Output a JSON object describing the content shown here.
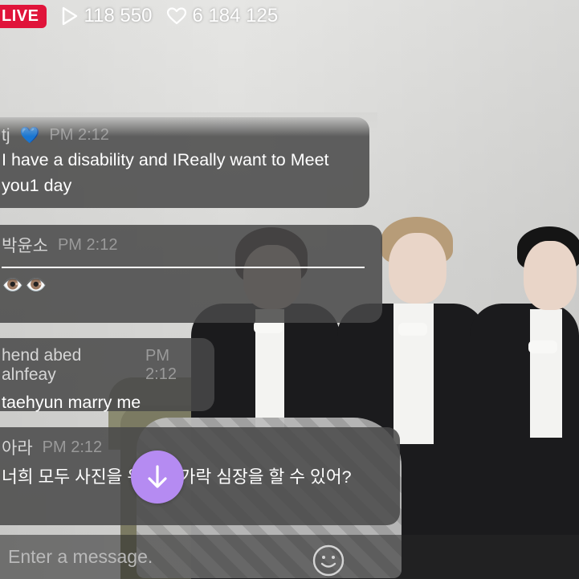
{
  "live": {
    "badge": "LIVE"
  },
  "stats": {
    "views": "118 550",
    "likes": "6 184 125"
  },
  "chat": {
    "messages": [
      {
        "author": "tj",
        "author_emoji": "💙",
        "time": "PM 2:12",
        "text": "I have a disability and IReally want to Meet you1 day"
      },
      {
        "author": "박윤소",
        "time": "PM 2:12",
        "text": "👁️👁️"
      },
      {
        "author": "hend abed alnfeay",
        "time": "PM 2:12",
        "text": "taehyun marry me"
      },
      {
        "author": "아라",
        "time": "PM 2:12",
        "text": "너희 모두 사진을 위해 손가락 심장을 할 수 있어?"
      }
    ]
  },
  "input": {
    "placeholder": "Enter a message."
  },
  "icons": {
    "play": "play-icon",
    "heart": "heart-icon",
    "scroll": "arrow-down-icon",
    "emoji": "smiley-icon"
  },
  "colors": {
    "live": "#e0143a",
    "scroll_button": "#b58bf2"
  }
}
